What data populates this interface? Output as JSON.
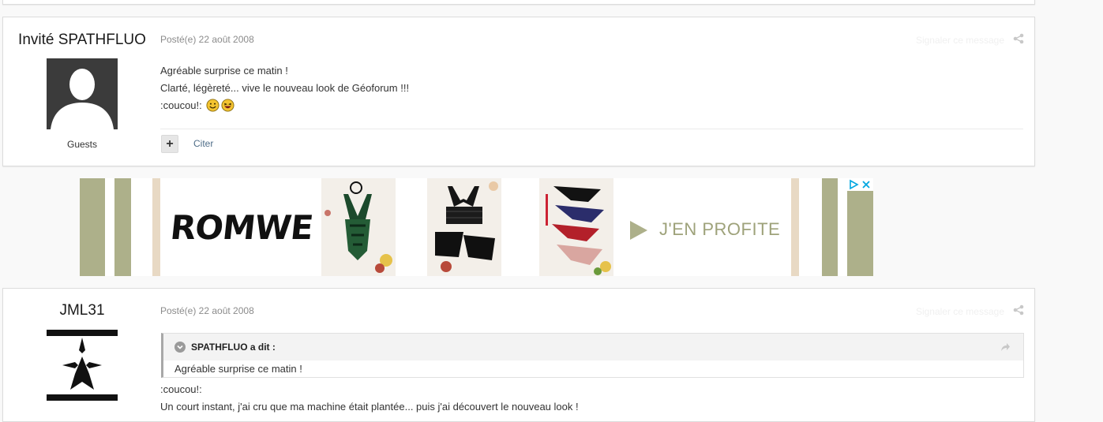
{
  "posts": [
    {
      "author": "Invité SPATHFLUO",
      "group": "Guests",
      "date": "Posté(e) 22 août 2008",
      "report": "Signaler ce message",
      "lines": [
        "Agréable surprise ce matin !",
        "Clarté, légèreté... vive le nouveau look de Géoforum !!!",
        ":coucou!:"
      ],
      "actions": {
        "plus": "+",
        "quote": "Citer"
      }
    },
    {
      "author": "JML31",
      "date": "Posté(e) 22 août 2008",
      "report": "Signaler ce message",
      "quote": {
        "author": "SPATHFLUO a dit :",
        "text": "Agréable surprise ce matin !"
      },
      "lines": [
        ":coucou!:",
        "Un court instant, j'ai cru que ma machine était plantée... puis j'ai découvert le nouveau look !"
      ]
    }
  ],
  "ad": {
    "brand": "ROMWE",
    "cta": "J'EN PROFITE",
    "colors": {
      "stripe": "#adb08a",
      "cta": "#9ea27a"
    }
  },
  "icons": {
    "share": "share-icon",
    "emoticons": [
      "smile-icon",
      "laugh-icon"
    ],
    "avatar": "default-avatar-icon",
    "flag": "hermine-flag-icon"
  }
}
